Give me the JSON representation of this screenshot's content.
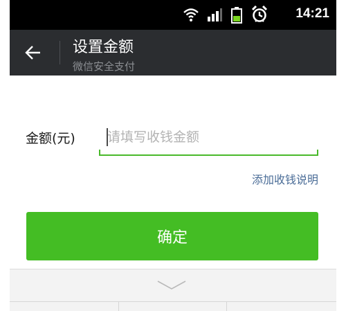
{
  "status_bar": {
    "time": "14:21",
    "icons": [
      "wifi-icon",
      "signal-icon",
      "battery-icon",
      "alarm-icon"
    ]
  },
  "action_bar": {
    "back_icon": "arrow-left-icon",
    "title": "设置金额",
    "subtitle": "微信安全支付"
  },
  "form": {
    "amount_label": "金额(元)",
    "amount_value": "",
    "amount_placeholder": "请填写收钱金额",
    "add_note_link": "添加收钱说明",
    "confirm_button": "确定"
  },
  "keyboard": {
    "collapse_icon": "chevron-down-icon"
  },
  "colors": {
    "status_bar_bg": "#000000",
    "action_bar_bg": "#2b2d30",
    "accent_green": "#44bd24",
    "link_blue": "#4a6c97",
    "keyboard_bg": "#f3f3f3"
  }
}
